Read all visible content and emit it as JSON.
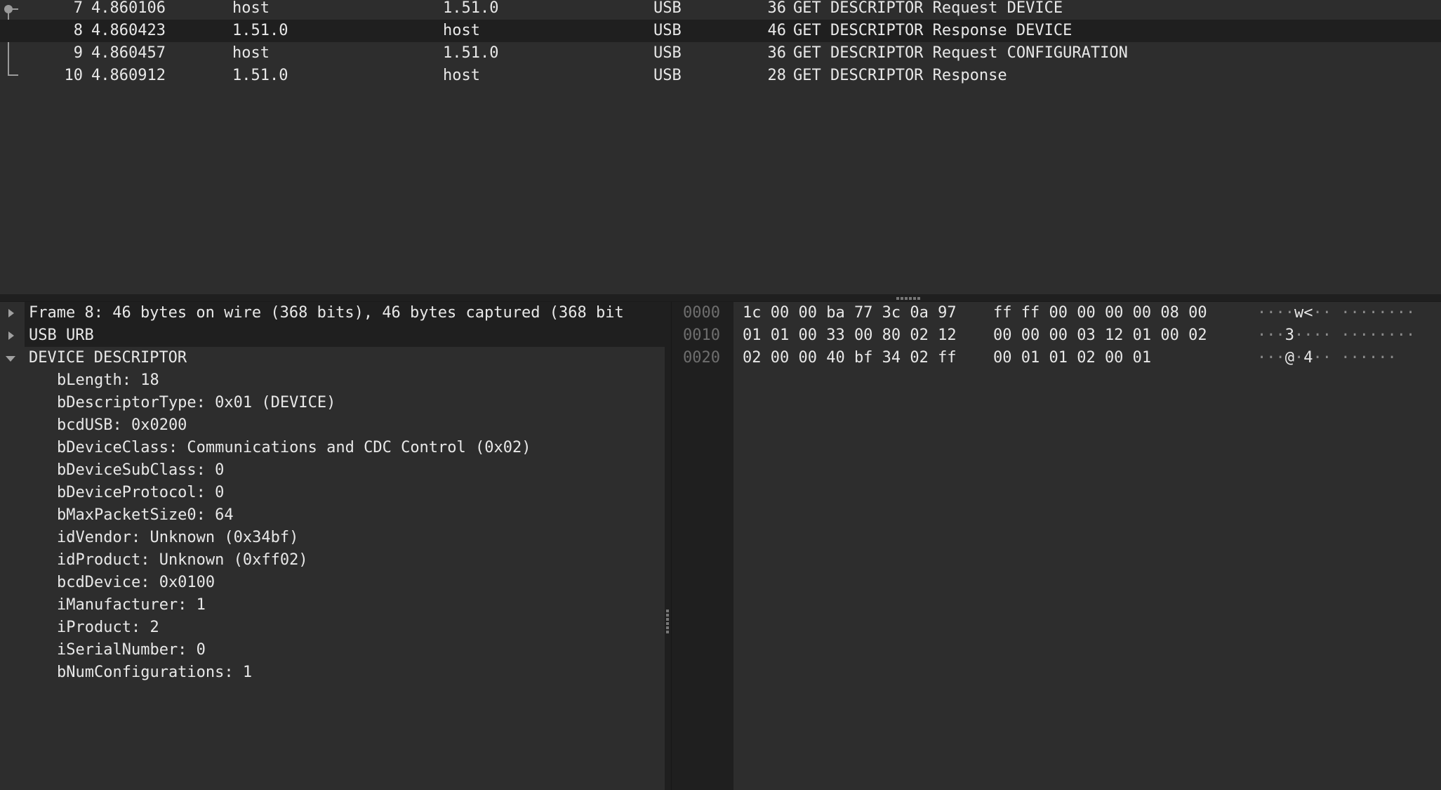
{
  "packet_list": {
    "rows": [
      {
        "no": "7",
        "time": "4.860106",
        "source": "host",
        "destination": "1.51.0",
        "protocol": "USB",
        "length": "36",
        "info": "GET DESCRIPTOR Request DEVICE",
        "selected": false
      },
      {
        "no": "8",
        "time": "4.860423",
        "source": "1.51.0",
        "destination": "host",
        "protocol": "USB",
        "length": "46",
        "info": "GET DESCRIPTOR Response DEVICE",
        "selected": true
      },
      {
        "no": "9",
        "time": "4.860457",
        "source": "host",
        "destination": "1.51.0",
        "protocol": "USB",
        "length": "36",
        "info": "GET DESCRIPTOR Request CONFIGURATION",
        "selected": false
      },
      {
        "no": "10",
        "time": "4.860912",
        "source": "1.51.0",
        "destination": "host",
        "protocol": "USB",
        "length": "28",
        "info": "GET DESCRIPTOR Response",
        "selected": false
      }
    ]
  },
  "details": {
    "tree": [
      {
        "label": "Frame 8: 46 bytes on wire (368 bits), 46 bytes captured (368 bit",
        "expanded": false,
        "icon": "expand-arrow-icon"
      },
      {
        "label": "USB URB",
        "expanded": false,
        "icon": "expand-arrow-icon"
      },
      {
        "label": "DEVICE DESCRIPTOR",
        "expanded": true,
        "icon": "collapse-arrow-icon",
        "children": [
          "bLength: 18",
          "bDescriptorType: 0x01 (DEVICE)",
          "bcdUSB: 0x0200",
          "bDeviceClass: Communications and CDC Control (0x02)",
          "bDeviceSubClass: 0",
          "bDeviceProtocol: 0",
          "bMaxPacketSize0: 64",
          "idVendor: Unknown (0x34bf)",
          "idProduct: Unknown (0xff02)",
          "bcdDevice: 0x0100",
          "iManufacturer: 1",
          "iProduct: 2",
          "iSerialNumber: 0",
          "bNumConfigurations: 1"
        ]
      }
    ]
  },
  "hex": {
    "rows": [
      {
        "offset": "0000",
        "bytes1": "1c 00 00 ba 77 3c 0a 97",
        "bytes2": "ff ff 00 00 00 00 08 00",
        "ascii": "····w<·· ········"
      },
      {
        "offset": "0010",
        "bytes1": "01 01 00 33 00 80 02 12",
        "bytes2": "00 00 00 03 12 01 00 02",
        "ascii": "···3···· ········"
      },
      {
        "offset": "0020",
        "bytes1": "02 00 00 40 bf 34 02 ff",
        "bytes2": "00 01 01 02 00 01",
        "ascii": "···@·4·· ······"
      }
    ]
  },
  "colors": {
    "background": "#2d2d2d",
    "selected_row": "#1f1f1f",
    "text": "#e8e8e8",
    "offset_text": "#6e6e6e"
  }
}
